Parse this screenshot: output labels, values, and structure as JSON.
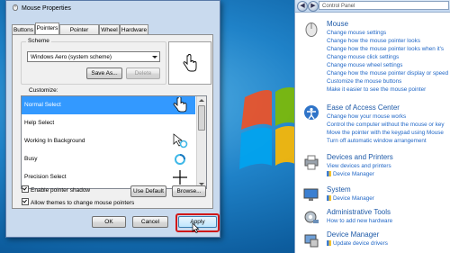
{
  "dialog": {
    "title": "Mouse Properties",
    "tabs": [
      "Buttons",
      "Pointers",
      "Pointer Options",
      "Wheel",
      "Hardware"
    ],
    "active_tab": "Pointers",
    "scheme_label": "Scheme",
    "scheme_value": "Windows Aero (system scheme)",
    "save_as_label": "Save As...",
    "delete_label": "Delete",
    "customize_label": "Customize:",
    "pointers": [
      "Normal Select",
      "Help Select",
      "Working In Background",
      "Busy",
      "Precision Select"
    ],
    "selected_pointer": "Normal Select",
    "enable_shadow_label": "Enable pointer shadow",
    "enable_shadow_checked": true,
    "allow_themes_label": "Allow themes to change mouse pointers",
    "allow_themes_checked": true,
    "use_default_label": "Use Default",
    "browse_label": "Browse...",
    "ok_label": "OK",
    "cancel_label": "Cancel",
    "apply_label": "Apply"
  },
  "control_panel": {
    "address": "Control Panel",
    "categories": [
      {
        "title": "Mouse",
        "icon": "mouse-icon",
        "links": [
          "Change mouse settings",
          "Change how the mouse pointer looks",
          "Change how the mouse pointer looks when it's",
          "Change mouse click settings",
          "Change mouse wheel settings",
          "Change how the mouse pointer display or speed",
          "Customize the mouse buttons",
          "Make it easier to see the mouse pointer"
        ]
      },
      {
        "title": "Ease of Access Center",
        "icon": "ease-of-access-icon",
        "links": [
          "Change how your mouse works",
          "Control the computer without the mouse or key",
          "Move the pointer with the keypad using Mouse",
          "Turn off automatic window arrangement"
        ]
      },
      {
        "title": "Devices and Printers",
        "icon": "printer-icon",
        "links": [
          "View devices and printers",
          "Device Manager"
        ]
      },
      {
        "title": "System",
        "icon": "system-icon",
        "links": [
          "Device Manager"
        ]
      },
      {
        "title": "Administrative Tools",
        "icon": "admin-tools-icon",
        "links": [
          "How to add new hardware"
        ]
      },
      {
        "title": "Device Manager",
        "icon": "device-manager-icon",
        "links": [
          "Update device drivers"
        ]
      }
    ]
  },
  "colors": {
    "highlight": "#d01818",
    "selection": "#3399ff",
    "link": "#1f66c6"
  }
}
